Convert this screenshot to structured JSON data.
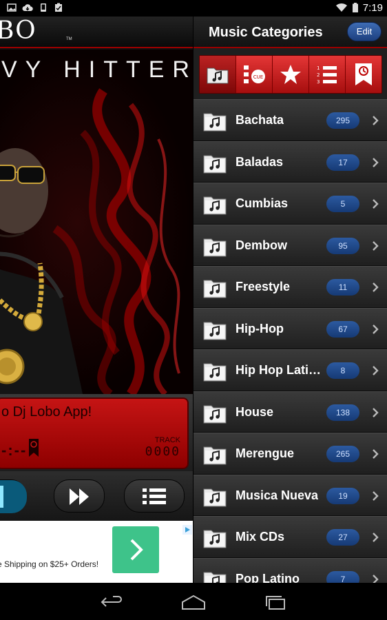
{
  "status_bar": {
    "time": "7:19",
    "left_icons": [
      "image-icon",
      "cloud-download-icon",
      "phone-icon",
      "clipboard-check-icon"
    ],
    "right_icons": [
      "wifi-icon",
      "battery-icon"
    ]
  },
  "player": {
    "brand": "BO",
    "brand_mark": "TM",
    "poster_title": "VY HITTER",
    "now_playing_text": "o Dj Lobo App!",
    "track_label": "TRACK",
    "track_digits": "0000",
    "time_digits": "-:--",
    "controls": [
      "play-icon",
      "fast-forward-icon",
      "playlist-icon"
    ]
  },
  "ad": {
    "text": "e Shipping on $25+ Orders!",
    "go_icon": "chevron-right-icon",
    "info_icon": "ad-choices-icon",
    "accent": "#3ec38a"
  },
  "header": {
    "title": "Music Categories",
    "edit_label": "Edit"
  },
  "toolbar": {
    "tools": [
      "music-folder-icon",
      "cue-icon",
      "star-icon",
      "numbered-list-icon",
      "history-bookmark-icon"
    ],
    "active_index": 0
  },
  "categories": [
    {
      "name": "Bachata",
      "count": "295"
    },
    {
      "name": "Baladas",
      "count": "17"
    },
    {
      "name": "Cumbias",
      "count": "5"
    },
    {
      "name": "Dembow",
      "count": "95"
    },
    {
      "name": "Freestyle",
      "count": "11"
    },
    {
      "name": "Hip-Hop",
      "count": "67"
    },
    {
      "name": "Hip Hop Latino",
      "count": "8"
    },
    {
      "name": "House",
      "count": "138"
    },
    {
      "name": "Merengue",
      "count": "265"
    },
    {
      "name": "Musica Nueva",
      "count": "19"
    },
    {
      "name": "Mix CDs",
      "count": "27"
    },
    {
      "name": "Pop Latino",
      "count": "7"
    }
  ],
  "navbar": [
    "back-icon",
    "home-icon",
    "recent-apps-icon"
  ],
  "colors": {
    "accent_red": "#d32020",
    "badge_blue": "#2c5aa0",
    "header_border": "#9a0000"
  }
}
